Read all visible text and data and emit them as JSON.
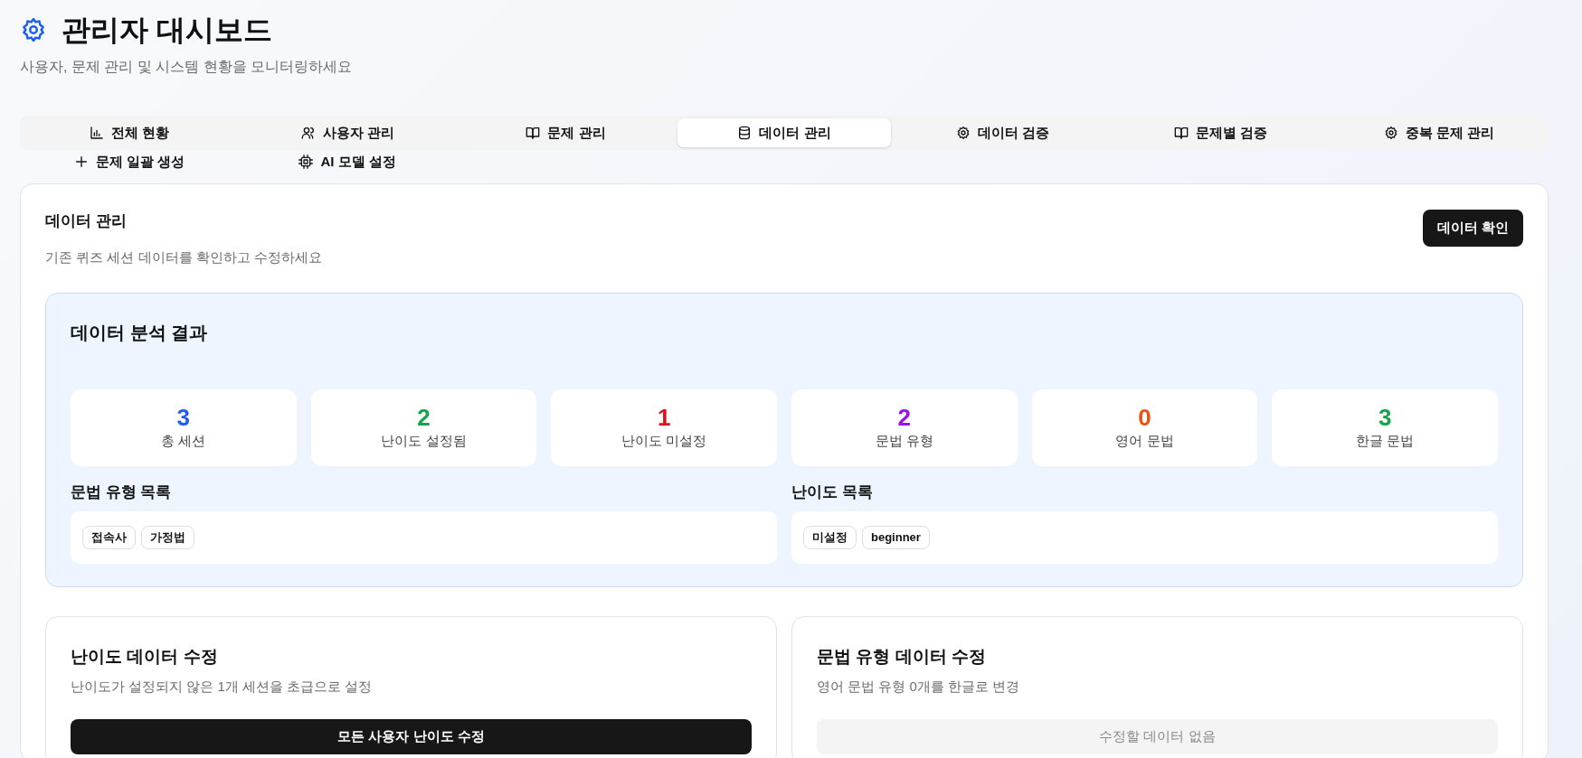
{
  "header": {
    "title": "관리자 대시보드",
    "subtitle": "사용자, 문제 관리 및 시스템 현황을 모니터링하세요"
  },
  "tabs": [
    {
      "label": "전체 현황",
      "kind": "chart",
      "selected": false
    },
    {
      "label": "사용자 관리",
      "kind": "users",
      "selected": false
    },
    {
      "label": "문제 관리",
      "kind": "book",
      "selected": false
    },
    {
      "label": "데이터 관리",
      "kind": "database",
      "selected": true
    },
    {
      "label": "데이터 검증",
      "kind": "gear",
      "selected": false
    },
    {
      "label": "문제별 검증",
      "kind": "book",
      "selected": false
    },
    {
      "label": "중복 문제 관리",
      "kind": "gear",
      "selected": false
    },
    {
      "label": "문제 일괄 생성",
      "kind": "plus",
      "selected": false
    },
    {
      "label": "AI 모델 설정",
      "kind": "chip",
      "selected": false
    }
  ],
  "panel": {
    "title": "데이터 관리",
    "description": "기존 퀴즈 세션 데이터를 확인하고 수정하세요",
    "button": "데이터 확인",
    "analysis": {
      "title": "데이터 분석 결과",
      "stats": [
        {
          "value": "3",
          "label": "총 세션",
          "color": "#1d5cf5"
        },
        {
          "value": "2",
          "label": "난이도 설정됨",
          "color": "#16a34a"
        },
        {
          "value": "1",
          "label": "난이도 미설정",
          "color": "#e0101c"
        },
        {
          "value": "2",
          "label": "문법 유형",
          "color": "#9b10f0"
        },
        {
          "value": "0",
          "label": "영어 문법",
          "color": "#f05010"
        },
        {
          "value": "3",
          "label": "한글 문법",
          "color": "#16a34a"
        }
      ],
      "lists": [
        {
          "title": "문법 유형 목록",
          "tags": [
            "접속사",
            "가정법"
          ]
        },
        {
          "title": "난이도 목록",
          "tags": [
            "미설정",
            "beginner"
          ]
        }
      ]
    },
    "fix_cards": [
      {
        "title": "난이도 데이터 수정",
        "description": "난이도가 설정되지 않은 1개 세션을 초급으로 설정",
        "button": "모든 사용자 난이도 수정",
        "disabled": false
      },
      {
        "title": "문법 유형 데이터 수정",
        "description": "영어 문법 유형 0개를 한글로 변경",
        "button": "수정할 데이터 없음",
        "disabled": true
      }
    ]
  }
}
